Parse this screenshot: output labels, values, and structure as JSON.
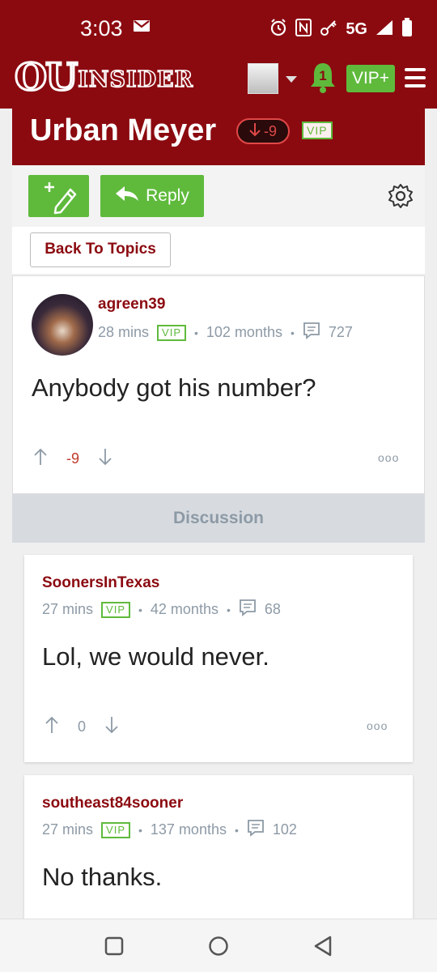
{
  "status_bar": {
    "time": "3:03",
    "network": "5G"
  },
  "header": {
    "logo_ou": "OU",
    "logo_insider": "INSIDER",
    "notification_count": "1",
    "vip_label": "VIP+"
  },
  "topic": {
    "title": "Urban Meyer",
    "score": "-9",
    "vip_label": "VIP"
  },
  "toolbar": {
    "reply_label": "Reply"
  },
  "back_label": "Back To Topics",
  "main_post": {
    "author": "agreen39",
    "time": "28 mins",
    "vip_label": "VIP",
    "tenure": "102 months",
    "post_count": "727",
    "body": "Anybody got his number?",
    "score": "-9",
    "more": "ooo"
  },
  "discussion_label": "Discussion",
  "replies": [
    {
      "author": "SoonersInTexas",
      "time": "27 mins",
      "vip_label": "VIP",
      "tenure": "42 months",
      "post_count": "68",
      "body": "Lol, we would never.",
      "score": "0",
      "more": "ooo"
    },
    {
      "author": "southeast84sooner",
      "time": "27 mins",
      "vip_label": "VIP",
      "tenure": "137 months",
      "post_count": "102",
      "body": "No thanks."
    }
  ],
  "colors": {
    "brand": "#8b0a10",
    "accent_green": "#5fba3c",
    "muted": "#8d9aa6",
    "negative": "#c0392b"
  }
}
